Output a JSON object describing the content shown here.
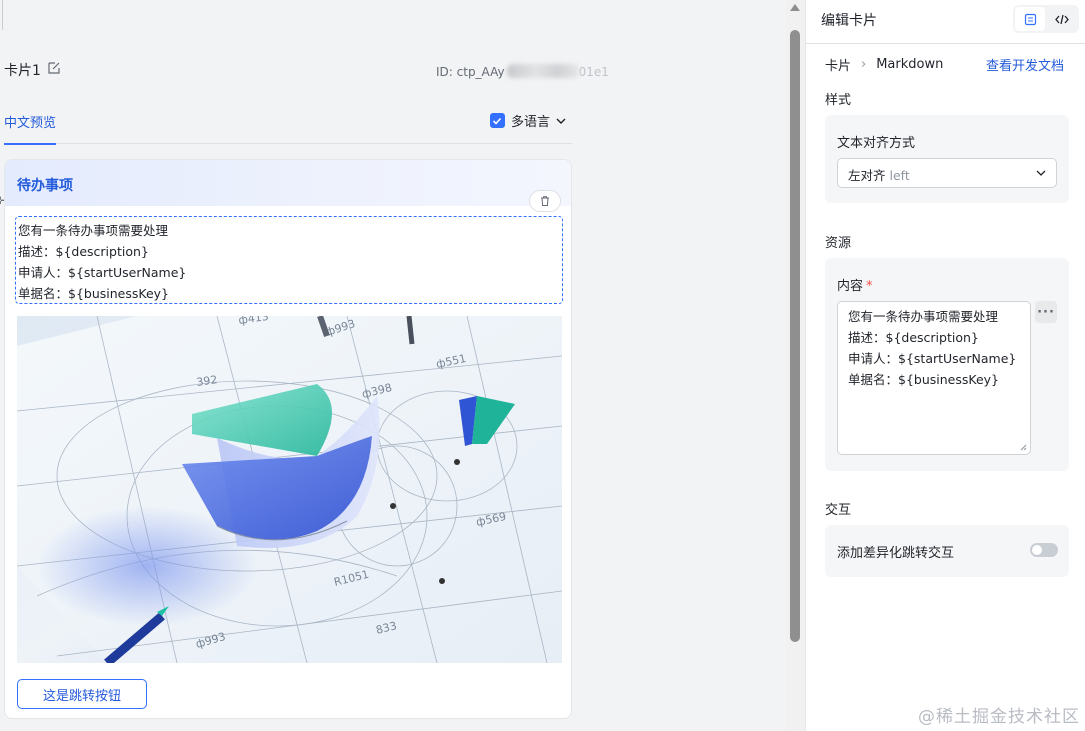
{
  "canvas": {
    "card_name": "卡片1",
    "card_id": "ID: ctp_AAy",
    "card_id_tail": "01e1",
    "tab_preview": "中文预览",
    "multilang_label": "多语言",
    "card": {
      "header_title": "待办事项",
      "markdown_lines": [
        "您有一条待办事项需要处理",
        "描述：${description}",
        "申请人：${startUserName}",
        "单据名：${businessKey}"
      ],
      "button_label": "这是跳转按钮",
      "image_labels": [
        "ф993",
        "392",
        "ф398",
        "ф551",
        "ф569",
        "R1051",
        "833",
        "ф993",
        "ф413"
      ]
    }
  },
  "panel": {
    "title": "编辑卡片",
    "breadcrumb": [
      "卡片",
      "Markdown"
    ],
    "doc_link": "查看开发文档",
    "style_section": "样式",
    "align_label": "文本对齐方式",
    "align_value": "左对齐",
    "align_hint": "left",
    "resource_section": "资源",
    "content_label": "内容",
    "content_required": "*",
    "content_lines": [
      "您有一条待办事项需要处理",
      "描述：${description}",
      "申请人：${startUserName}",
      "单据名：${businessKey}"
    ],
    "more_label": "···",
    "interaction_section": "交互",
    "interaction_label": "添加差异化跳转交互",
    "interaction_enabled": false
  },
  "watermark": "@稀土掘金技术社区",
  "colors": {
    "accent": "#3370ff",
    "link": "#245bdb",
    "required": "#f54a45"
  }
}
